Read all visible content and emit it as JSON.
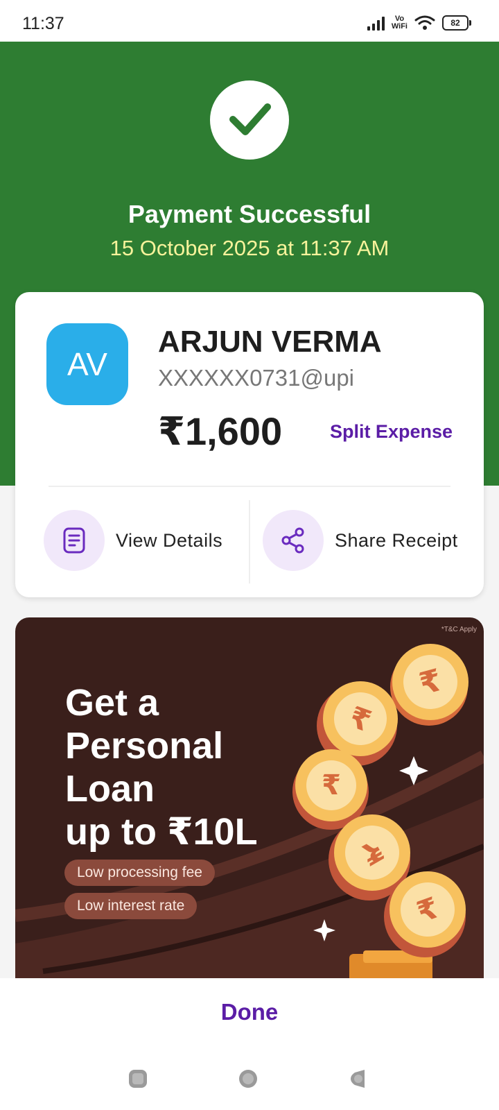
{
  "status_bar": {
    "time": "11:37",
    "network_label_top": "Vo",
    "network_label_bottom": "WiFi",
    "battery": "82"
  },
  "header": {
    "title": "Payment Successful",
    "datetime": "15 October 2025 at 11:37 AM",
    "icon": "checkmark-icon",
    "background_color": "#2e7d32"
  },
  "payee": {
    "initials": "AV",
    "name": "ARJUN VERMA",
    "upi_id": "XXXXXX0731@upi",
    "amount": "₹1,600",
    "split_label": "Split Expense"
  },
  "actions": [
    {
      "label": "View Details",
      "icon": "document-icon"
    },
    {
      "label": "Share Receipt",
      "icon": "share-icon"
    }
  ],
  "banner": {
    "tc": "*T&C Apply",
    "headline": [
      "Get a",
      "Personal",
      "Loan",
      "up to ₹10L"
    ],
    "chips": [
      "Low processing fee",
      "Low interest rate"
    ],
    "coin_symbol": "₹"
  },
  "footer": {
    "done_label": "Done"
  },
  "colors": {
    "accent_purple": "#5b1da6",
    "success_green": "#2e7d32",
    "avatar_blue": "#2aaee9",
    "banner_brown": "#3a1f1b"
  }
}
